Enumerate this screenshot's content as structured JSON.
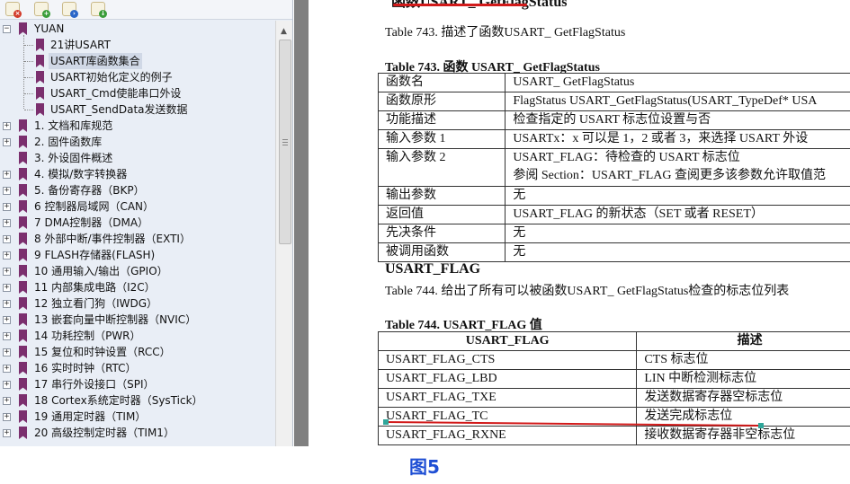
{
  "toolbar": {
    "icons": [
      "delete-bookmark-icon",
      "add-bookmark-icon",
      "goto-bookmark-icon",
      "expand-bookmark-icon"
    ]
  },
  "tree": {
    "root_label": "YUAN",
    "children": [
      "21讲USART",
      "USART库函数集合",
      "USART初始化定义的例子",
      "USART_Cmd使能串口外设",
      "USART_SendData发送数据"
    ],
    "selected_index": 1,
    "chapters": [
      "1. 文档和库规范",
      "2. 固件函数库",
      "3. 外设固件概述",
      "4. 模拟/数字转换器",
      "5. 备份寄存器（BKP）",
      "6 控制器局域网（CAN）",
      "7  DMA控制器（DMA）",
      "8 外部中断/事件控制器（EXTI）",
      "9 FLASH存储器(FLASH)",
      "10 通用输入/输出（GPIO）",
      "11 内部集成电路（I2C）",
      "12 独立看门狗（IWDG）",
      "13 嵌套向量中断控制器（NVIC）",
      "14 功耗控制（PWR）",
      "15 复位和时钟设置（RCC）",
      "16 实时时钟（RTC）",
      "17 串行外设接口（SPI）",
      "18 Cortex系统定时器（SysTick）",
      "19 通用定时器（TIM）",
      "20 高级控制定时器（TIM1）"
    ],
    "expandable": [
      true,
      true,
      false,
      true,
      true,
      true,
      true,
      true,
      true,
      true,
      true,
      true,
      true,
      true,
      true,
      true,
      true,
      true,
      true,
      true
    ]
  },
  "doc": {
    "top_heading": "函数USART_ GetFlagStatus",
    "intro": "Table 743.  描述了函数USART_ GetFlagStatus",
    "table743_title": "Table 743.  函数 USART_ GetFlagStatus",
    "table743": [
      [
        "函数名",
        "USART_ GetFlagStatus"
      ],
      [
        "函数原形",
        "FlagStatus USART_GetFlagStatus(USART_TypeDef* USA"
      ],
      [
        "功能描述",
        "检查指定的 USART 标志位设置与否"
      ],
      [
        "输入参数 1",
        "USARTx：x 可以是 1，2 或者 3，来选择 USART 外设"
      ],
      [
        "输入参数 2",
        "USART_FLAG：待检查的 USART 标志位",
        "参阅 Section：USART_FLAG 查阅更多该参数允许取值范"
      ],
      [
        "输出参数",
        "无"
      ],
      [
        "返回值",
        "USART_FLAG 的新状态（SET 或者 RESET）"
      ],
      [
        "先决条件",
        "无"
      ],
      [
        "被调用函数",
        "无"
      ]
    ],
    "flag_heading": "USART_FLAG",
    "flag_intro": "Table 744.  给出了所有可以被函数USART_ GetFlagStatus检查的标志位列表",
    "table744_title": "Table 744. USART_FLAG 值",
    "table744_headers": [
      "USART_FLAG",
      "描述"
    ],
    "table744": [
      [
        "USART_FLAG_CTS",
        "CTS 标志位"
      ],
      [
        "USART_FLAG_LBD",
        "LIN 中断检测标志位"
      ],
      [
        "USART_FLAG_TXE",
        "发送数据寄存器空标志位"
      ],
      [
        "USART_FLAG_TC",
        "发送完成标志位"
      ],
      [
        "USART_FLAG_RXNE",
        "接收数据寄存器非空标志位"
      ]
    ],
    "figure_caption": "图5"
  },
  "colors": {
    "panel_bg": "#e9eef6",
    "bookmark": "#7b2f6e",
    "annotation_red": "#d21a1a",
    "caption_blue": "#1f4fd4",
    "splitter": "#808080"
  }
}
